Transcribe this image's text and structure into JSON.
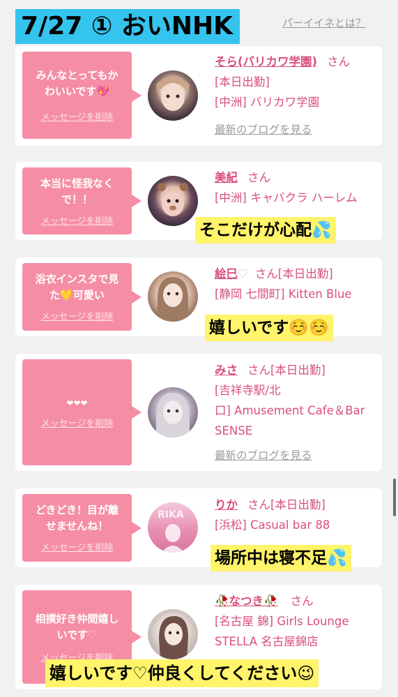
{
  "header": {
    "date_banner": "7/27 ① おいNHK",
    "link": "パーイイネとは？"
  },
  "cards": [
    {
      "message": "みんなとってもか\nわいいです💖",
      "delete": "メッセージを削除",
      "name": "そら(バリカワ学園)",
      "honorific": "さん",
      "status": "[本日出勤]",
      "shop": "[中洲] バリカワ学園",
      "blog": "最新のブログを見る"
    },
    {
      "message": "本当に怪我なく\nで！！",
      "delete": "メッセージを削除",
      "name": "美紀",
      "honorific": "さん",
      "shop": "[中洲] キャバクラ ハーレム",
      "caption": "そこだけが心配💦"
    },
    {
      "message": "浴衣インスタで見\nた💛可愛い",
      "delete": "メッセージを削除",
      "name": "絵巳",
      "name_heart": "♡",
      "honorific": "さん",
      "status": "[本日出勤]",
      "shop": "[静岡 七間町] Kitten Blue",
      "caption": "嬉しいです☺️☺️"
    },
    {
      "message": "❤❤❤",
      "delete": "メッセージを削除",
      "name": "みさ",
      "honorific": "さん",
      "status": "[本日出勤]",
      "shop_line1": "[吉祥寺駅/北",
      "shop_line2": "口] Amusement Cafe＆Bar",
      "shop_line3": "SENSE",
      "blog": "最新のブログを見る"
    },
    {
      "message": "どきどき！目が離\nせませんね！",
      "delete": "メッセージを削除",
      "name": "りか",
      "honorific": "さん",
      "status": "[本日出勤]",
      "shop": "[浜松] Casual bar 88",
      "caption": "場所中は寝不足💦"
    },
    {
      "message_main": "相撲好き仲間嬉し\nいです",
      "message_heart": "♡",
      "delete": "メッセージを削除",
      "name": "🥀なつき🥀",
      "honorific": "さん",
      "shop_line1": "[名古屋 錦] Girls Lounge",
      "shop_line2": "STELLA 名古屋錦店",
      "caption": "嬉しいです♡仲良くしてください😉"
    }
  ],
  "colors": {
    "pink_bubble": "#f58ea5",
    "pink_text": "#d94f79",
    "banner_blue": "#34c4ee",
    "caption_yellow": "#fff46a",
    "background": "#f1f1f2"
  }
}
